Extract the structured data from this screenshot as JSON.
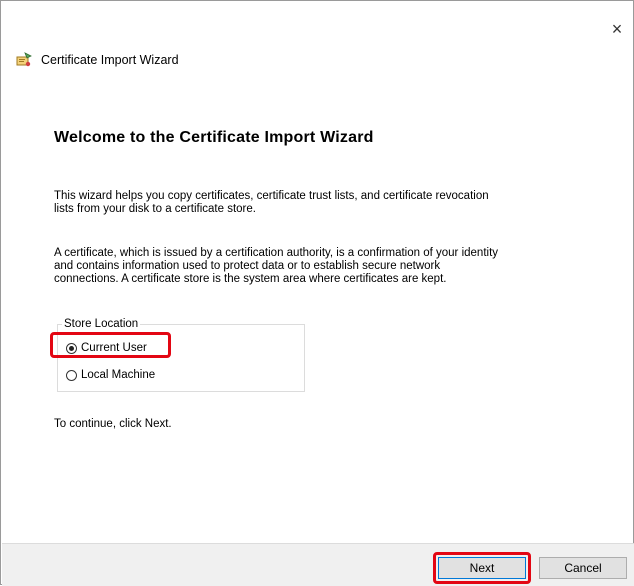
{
  "window": {
    "title": "Certificate Import Wizard",
    "close_glyph": "×"
  },
  "page": {
    "heading": "Welcome to the Certificate Import Wizard",
    "paragraph1_line1": "This wizard helps you copy certificates, certificate trust lists, and certificate revocation",
    "paragraph1_line2": "lists from your disk to a certificate store.",
    "paragraph2_line1": "A certificate, which is issued by a certification authority, is a confirmation of your identity",
    "paragraph2_line2": "and contains information used to protect data or to establish secure network",
    "paragraph2_line3": "connections. A certificate store is the system area where certificates are kept.",
    "continue_text": "To continue, click Next."
  },
  "store_location": {
    "legend": "Store Location",
    "options": [
      {
        "label": "Current User",
        "selected": true
      },
      {
        "label": "Local Machine",
        "selected": false
      }
    ]
  },
  "footer": {
    "next_label": "Next",
    "cancel_label": "Cancel"
  },
  "colors": {
    "highlight": "#e30613",
    "footer_bg": "#f0f0f0",
    "button_bg": "#e1e1e1",
    "default_button_border": "#0078d7"
  },
  "icons": {
    "title_icon": "certificate-wizard-icon",
    "close_icon": "close-icon"
  }
}
